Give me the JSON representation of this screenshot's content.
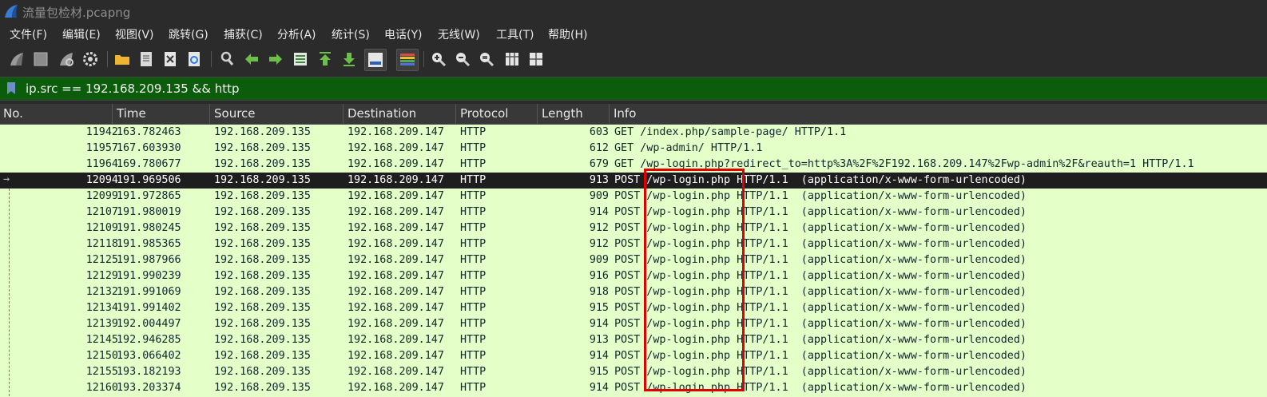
{
  "window": {
    "title": "流量包检材.pcapng"
  },
  "menu": [
    "文件(F)",
    "编辑(E)",
    "视图(V)",
    "跳转(G)",
    "捕获(C)",
    "分析(A)",
    "统计(S)",
    "电话(Y)",
    "无线(W)",
    "工具(T)",
    "帮助(H)"
  ],
  "toolbar_icons": [
    "shark-fin-start-icon",
    "stop-square-icon",
    "shark-fin-restart-icon",
    "gear-options-icon",
    "open-folder-icon",
    "save-file-icon",
    "close-file-icon",
    "reload-icon",
    "find-magnifier-icon",
    "arrow-left-icon",
    "arrow-right-icon",
    "go-to-packet-icon",
    "arrow-up-icon",
    "arrow-down-icon",
    "autoscroll-icon",
    "colorize-icon",
    "zoom-in-icon",
    "zoom-out-icon",
    "zoom-reset-icon",
    "resize-columns-icon",
    "layout-grid-icon"
  ],
  "filter": {
    "text": "ip.src == 192.168.209.135 && http",
    "color": "#0b5d0b"
  },
  "columns": [
    "No.",
    "Time",
    "Source",
    "Destination",
    "Protocol",
    "Length",
    "Info"
  ],
  "packets": [
    {
      "no": "11942",
      "time": "163.782463",
      "src": "192.168.209.135",
      "dst": "192.168.209.147",
      "proto": "HTTP",
      "len": "603",
      "info": "GET /index.php/sample-page/ HTTP/1.1"
    },
    {
      "no": "11957",
      "time": "167.603930",
      "src": "192.168.209.135",
      "dst": "192.168.209.147",
      "proto": "HTTP",
      "len": "612",
      "info": "GET /wp-admin/ HTTP/1.1"
    },
    {
      "no": "11964",
      "time": "169.780677",
      "src": "192.168.209.135",
      "dst": "192.168.209.147",
      "proto": "HTTP",
      "len": "679",
      "info": "GET /wp-login.php?redirect_to=http%3A%2F%2F192.168.209.147%2Fwp-admin%2F&reauth=1 HTTP/1.1"
    },
    {
      "no": "12094",
      "time": "191.969506",
      "src": "192.168.209.135",
      "dst": "192.168.209.147",
      "proto": "HTTP",
      "len": "913",
      "info": "POST /wp-login.php HTTP/1.1  (application/x-www-form-urlencoded)",
      "selected": true
    },
    {
      "no": "12099",
      "time": "191.972865",
      "src": "192.168.209.135",
      "dst": "192.168.209.147",
      "proto": "HTTP",
      "len": "909",
      "info": "POST /wp-login.php HTTP/1.1  (application/x-www-form-urlencoded)"
    },
    {
      "no": "12107",
      "time": "191.980019",
      "src": "192.168.209.135",
      "dst": "192.168.209.147",
      "proto": "HTTP",
      "len": "914",
      "info": "POST /wp-login.php HTTP/1.1  (application/x-www-form-urlencoded)"
    },
    {
      "no": "12109",
      "time": "191.980245",
      "src": "192.168.209.135",
      "dst": "192.168.209.147",
      "proto": "HTTP",
      "len": "912",
      "info": "POST /wp-login.php HTTP/1.1  (application/x-www-form-urlencoded)"
    },
    {
      "no": "12118",
      "time": "191.985365",
      "src": "192.168.209.135",
      "dst": "192.168.209.147",
      "proto": "HTTP",
      "len": "912",
      "info": "POST /wp-login.php HTTP/1.1  (application/x-www-form-urlencoded)"
    },
    {
      "no": "12125",
      "time": "191.987966",
      "src": "192.168.209.135",
      "dst": "192.168.209.147",
      "proto": "HTTP",
      "len": "909",
      "info": "POST /wp-login.php HTTP/1.1  (application/x-www-form-urlencoded)"
    },
    {
      "no": "12129",
      "time": "191.990239",
      "src": "192.168.209.135",
      "dst": "192.168.209.147",
      "proto": "HTTP",
      "len": "916",
      "info": "POST /wp-login.php HTTP/1.1  (application/x-www-form-urlencoded)"
    },
    {
      "no": "12132",
      "time": "191.991069",
      "src": "192.168.209.135",
      "dst": "192.168.209.147",
      "proto": "HTTP",
      "len": "918",
      "info": "POST /wp-login.php HTTP/1.1  (application/x-www-form-urlencoded)"
    },
    {
      "no": "12134",
      "time": "191.991402",
      "src": "192.168.209.135",
      "dst": "192.168.209.147",
      "proto": "HTTP",
      "len": "915",
      "info": "POST /wp-login.php HTTP/1.1  (application/x-www-form-urlencoded)"
    },
    {
      "no": "12139",
      "time": "192.004497",
      "src": "192.168.209.135",
      "dst": "192.168.209.147",
      "proto": "HTTP",
      "len": "914",
      "info": "POST /wp-login.php HTTP/1.1  (application/x-www-form-urlencoded)"
    },
    {
      "no": "12145",
      "time": "192.946285",
      "src": "192.168.209.135",
      "dst": "192.168.209.147",
      "proto": "HTTP",
      "len": "913",
      "info": "POST /wp-login.php HTTP/1.1  (application/x-www-form-urlencoded)"
    },
    {
      "no": "12150",
      "time": "193.066402",
      "src": "192.168.209.135",
      "dst": "192.168.209.147",
      "proto": "HTTP",
      "len": "914",
      "info": "POST /wp-login.php HTTP/1.1  (application/x-www-form-urlencoded)"
    },
    {
      "no": "12155",
      "time": "193.182193",
      "src": "192.168.209.135",
      "dst": "192.168.209.147",
      "proto": "HTTP",
      "len": "915",
      "info": "POST /wp-login.php HTTP/1.1  (application/x-www-form-urlencoded)"
    },
    {
      "no": "12160",
      "time": "193.203374",
      "src": "192.168.209.135",
      "dst": "192.168.209.147",
      "proto": "HTTP",
      "len": "914",
      "info": "POST /wp-login.php HTTP/1.1  (application/x-www-form-urlencoded)"
    }
  ],
  "colors": {
    "row_bg": "#e4ffc7",
    "selected_bg": "#1e1e1e",
    "highlight_box": "#e00000"
  }
}
